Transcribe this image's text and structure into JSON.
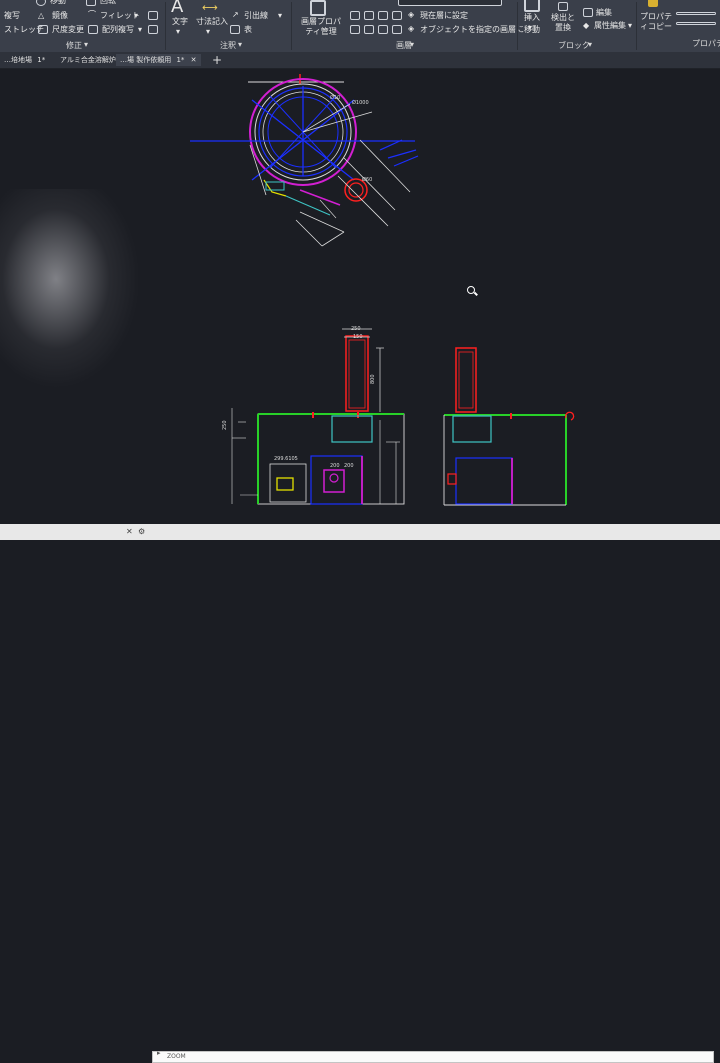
{
  "ribbon": {
    "modify": {
      "items": [
        "移動",
        "回転",
        "複写",
        "鏡像",
        "フィレット",
        "ストレッチ",
        "尺度変更",
        "配列複写"
      ],
      "title": "修正"
    },
    "annotation": {
      "items": [
        "文字",
        "寸法記入",
        "引出線",
        "表"
      ],
      "title": "注釈"
    },
    "layers": {
      "items": [
        "画層プロパティ管理",
        "現在層に設定",
        "オブジェクトを指定の画層に移動"
      ],
      "title": "画層"
    },
    "block": {
      "items": [
        "挿入",
        "検出と置換",
        "編集",
        "属性編集"
      ],
      "title": "ブロック"
    },
    "properties": {
      "items": [
        "プロパティコピー"
      ],
      "title": "プロパティ"
    }
  },
  "tabs": [
    {
      "label": "…培地場",
      "modified": "1*"
    },
    {
      "label": "アルミ合金溶解炉",
      "modified": ""
    },
    {
      "label": "…場 製作依頼用",
      "modified": "1*"
    }
  ],
  "drawing": {
    "top_view_dims": [
      "Ø10",
      "Ø1000",
      "Ø60"
    ],
    "side_view_dims": [
      "250",
      "150",
      "800"
    ],
    "front_view_dims": [
      "200",
      "200",
      "299.6105",
      "250"
    ]
  },
  "status": {
    "command_prompt": "ZOOM"
  },
  "colors": {
    "background": "#1b1d23",
    "ribbon": "#3a3f4a",
    "blue": "#1b2fff",
    "magenta": "#d21fd2",
    "red": "#ff2020",
    "yellow": "#e4e000",
    "cyan": "#3ec5c5",
    "green": "#28d128",
    "white": "#dcdcdc"
  }
}
